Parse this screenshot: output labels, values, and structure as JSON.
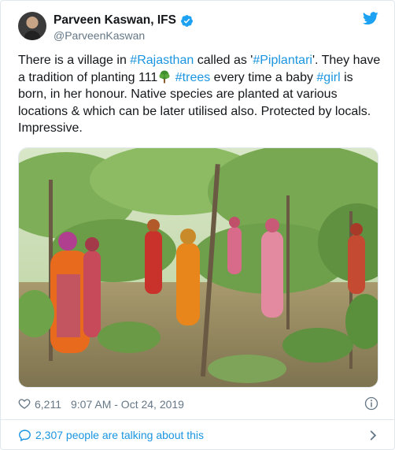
{
  "author": {
    "display_name": "Parveen Kaswan, IFS",
    "handle": "@ParveenKaswan"
  },
  "tweet": {
    "segments": [
      {
        "text": "There is a village in ",
        "link": false
      },
      {
        "text": "#Rajasthan",
        "link": true
      },
      {
        "text": " called as '",
        "link": false
      },
      {
        "text": "#Piplantari",
        "link": true
      },
      {
        "text": "'. They have a tradition of  planting 111",
        "link": false
      },
      {
        "text": " ",
        "link": false
      },
      {
        "text": "#trees",
        "link": true
      },
      {
        "text": " every time a baby ",
        "link": false
      },
      {
        "text": "#girl",
        "link": true
      },
      {
        "text": " is born, in her honour. Native species are planted at various locations & which can be later utilised also. Protected by locals. Impressive.",
        "link": false
      }
    ],
    "emoji": "deciduous-tree-icon"
  },
  "stats": {
    "likes": "6,211",
    "timestamp": "9:07 AM - Oct 24, 2019"
  },
  "footer": {
    "talking_label": "2,307 people are talking about this"
  },
  "colors": {
    "link": "#1b95e0",
    "text": "#14171a",
    "secondary": "#657786",
    "border": "#e1e8ed"
  },
  "icons": [
    "verified-badge-icon",
    "twitter-bird-icon",
    "heart-icon",
    "info-icon",
    "comment-icon",
    "chevron-right-icon"
  ]
}
